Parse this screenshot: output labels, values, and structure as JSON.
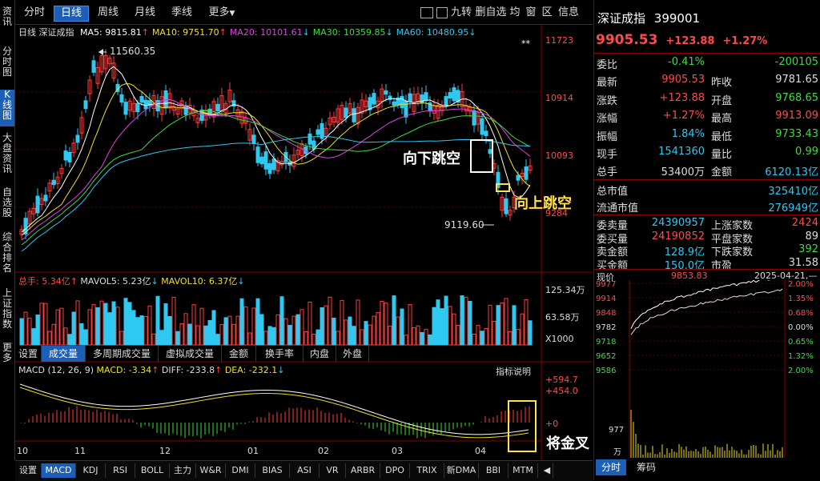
{
  "nav": {
    "items": [
      "资讯",
      "分时图",
      "K线图",
      "大盘资讯",
      "自选股",
      "综合排名",
      "上证指数",
      "更多"
    ]
  },
  "topbar": {
    "tabs": [
      "分时",
      "日线",
      "周线",
      "月线",
      "季线",
      "更多"
    ],
    "active": "日线",
    "more_arrow": "▼",
    "tools": [
      "九转",
      "删自选",
      "均",
      "窗",
      "区",
      "信息"
    ]
  },
  "kline": {
    "period": "日线",
    "index_name": "深证成指",
    "ma_labels": [
      {
        "text": "MA5: 9815.81",
        "arrow": "↑",
        "color": "#ffffff"
      },
      {
        "text": "MA10: 9751.70",
        "arrow": "↑",
        "color": "#f0e020"
      },
      {
        "text": "MA20: 10101.61",
        "arrow": "↓",
        "color": "#e040e0"
      },
      {
        "text": "MA30: 10359.85",
        "arrow": "↓",
        "color": "#3ddc3d"
      },
      {
        "text": "MA60: 10480.95",
        "arrow": "↓",
        "color": "#2ec8f0"
      }
    ],
    "star": "**",
    "high_label": "11560.35",
    "low_label": "9119.60",
    "price_axis": [
      "11723",
      "10914",
      "10093",
      "9284"
    ]
  },
  "volume": {
    "total_label": "总手: 5.34亿",
    "total_arrow": "↑",
    "mavol5": "MAVOL5: 5.23亿",
    "mavol5_arrow": "↓",
    "mavol10": "MAVOL10: 6.37亿",
    "mavol10_arrow": "↓",
    "axis": [
      "125.34万",
      "63.58万",
      "X1000"
    ]
  },
  "subtabs": [
    "设置",
    "成交量",
    "多周期成交量",
    "虚拟成交量",
    "金额",
    "换手率",
    "内盘",
    "外盘"
  ],
  "macd": {
    "label": "MACD (12, 26, 9)",
    "macd_val": "MACD: -3.34",
    "macd_arrow": "↑",
    "diff": "DIFF: -233.8",
    "diff_arrow": "↑",
    "dea": "DEA: -232.1",
    "dea_arrow": "↓",
    "help": "指标说明",
    "axis": [
      "+594.7",
      "+454.0",
      "+0"
    ]
  },
  "months": [
    "10",
    "11",
    "12",
    "01",
    "02",
    "03",
    "04"
  ],
  "annotations": {
    "gap_down": "向下跳空",
    "gap_up": "向上跳空",
    "golden": "将金叉"
  },
  "bottombar": [
    "设置",
    "MACD",
    "KDJ",
    "RSI",
    "BOLL",
    "主力",
    "W&R",
    "DMI",
    "BIAS",
    "ASI",
    "VR",
    "ARBR",
    "DPO",
    "TRIX",
    "新DMA",
    "BBI",
    "MTM"
  ],
  "bottom_active": "MACD",
  "quote": {
    "name": "深证成指",
    "code": "399001",
    "price": "9905.53",
    "change": "+123.88",
    "pct": "+1.27%",
    "rows": [
      {
        "l": "委比",
        "v": "-0.41%",
        "vc": "green",
        "l2": "",
        "v2": "-200105",
        "v2c": "green"
      },
      {
        "l": "最新",
        "v": "9905.53",
        "vc": "red",
        "l2": "昨收",
        "v2": "9781.65",
        "v2c": "white"
      },
      {
        "l": "涨跌",
        "v": "+123.88",
        "vc": "red",
        "l2": "开盘",
        "v2": "9768.65",
        "v2c": "green"
      },
      {
        "l": "涨幅",
        "v": "+1.27%",
        "vc": "red",
        "l2": "最高",
        "v2": "9913.09",
        "v2c": "red"
      },
      {
        "l": "振幅",
        "v": "1.84%",
        "vc": "cyan",
        "l2": "最低",
        "v2": "9733.43",
        "v2c": "green"
      },
      {
        "l": "现手",
        "v": "1541360",
        "vc": "cyan",
        "l2": "量比",
        "v2": "0.99",
        "v2c": "green"
      },
      {
        "l": "总手",
        "v": "53400万",
        "vc": "white",
        "l2": "金额",
        "v2": "6120.13亿",
        "v2c": "cyan"
      }
    ],
    "mktcap": [
      {
        "l": "总市值",
        "v": "325410亿"
      },
      {
        "l": "流通市值",
        "v": "276949亿"
      }
    ],
    "stats": [
      {
        "l": "委卖量",
        "v": "24390957",
        "vc": "cyan",
        "l2": "上涨家数",
        "v2": "2424",
        "v2c": "red"
      },
      {
        "l": "委买量",
        "v": "24190852",
        "vc": "red",
        "l2": "平盘家数",
        "v2": "89",
        "v2c": "white"
      },
      {
        "l": "卖金额",
        "v": "128.9亿",
        "vc": "cyan",
        "l2": "下跌家数",
        "v2": "392",
        "v2c": "green"
      },
      {
        "l": "买金额",
        "v": "150.0亿",
        "vc": "cyan",
        "l2": "市盈",
        "v2": "31.58",
        "v2c": "white"
      }
    ]
  },
  "mini": {
    "label": "现价",
    "price": "9853.83",
    "datetime": "2025-04-21,—",
    "price_axis": [
      "9977",
      "9914",
      "9848",
      "9782",
      "9718",
      "9652",
      "9586"
    ],
    "pct_axis": [
      "2.00%",
      "1.35%",
      "0.68%",
      "0.00%",
      "0.65%",
      "1.32%",
      "2.00%"
    ],
    "vol_axis": [
      "977",
      "万"
    ],
    "tabs": [
      "分时",
      "筹码"
    ]
  },
  "colors": {
    "up": "#ff3b3b",
    "down": "#2ec8f0",
    "ma5": "#ffffff",
    "ma10": "#f0e020",
    "ma20": "#e040e0",
    "ma30": "#3ddc3d",
    "ma60": "#2ec8f0"
  }
}
